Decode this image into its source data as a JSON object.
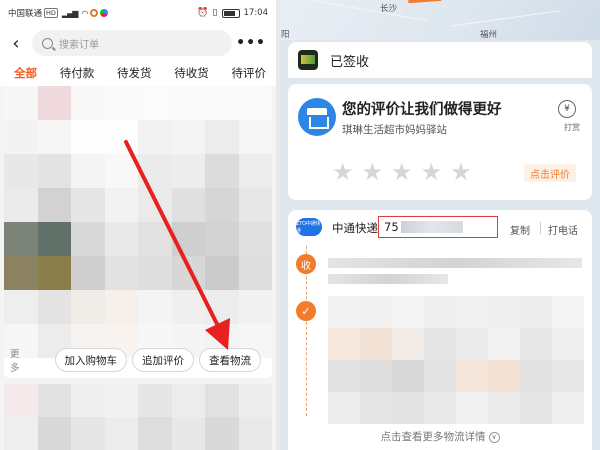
{
  "left": {
    "status_bar": {
      "carrier": "中国联通",
      "network_tag": "HD",
      "time": "17:04"
    },
    "search": {
      "placeholder": "搜索订单"
    },
    "tabs": [
      {
        "label": "全部",
        "active": true
      },
      {
        "label": "待付款",
        "active": false
      },
      {
        "label": "待发货",
        "active": false
      },
      {
        "label": "待收货",
        "active": false
      },
      {
        "label": "待评价",
        "active": false
      }
    ],
    "actions": {
      "more": "更多",
      "add_to_cart": "加入购物车",
      "add_review": "追加评价",
      "view_logistics": "查看物流"
    },
    "accent_color": "#f35a1d",
    "annotation_arrow_color": "#e8201f"
  },
  "right": {
    "map_labels": {
      "city_a": "长沙",
      "city_b": "福州",
      "city_c": "阳"
    },
    "status": {
      "title": "已签收"
    },
    "review": {
      "title": "您的评价让我们做得更好",
      "store_name": "琪琳生活超市妈妈驿站",
      "tip_label": "打赏",
      "tip_icon": "¥",
      "rate_button": "点击评价",
      "star_count": 5
    },
    "logistics": {
      "courier_logo_text": "ZTO中通快递",
      "courier_name": "中通快递",
      "tracking_prefix": "75",
      "copy": "复制",
      "call": "打电话",
      "received_node": "收",
      "check_node": "✓",
      "more_text": "点击查看更多物流详情",
      "highlight_color": "#e23b3b"
    }
  }
}
